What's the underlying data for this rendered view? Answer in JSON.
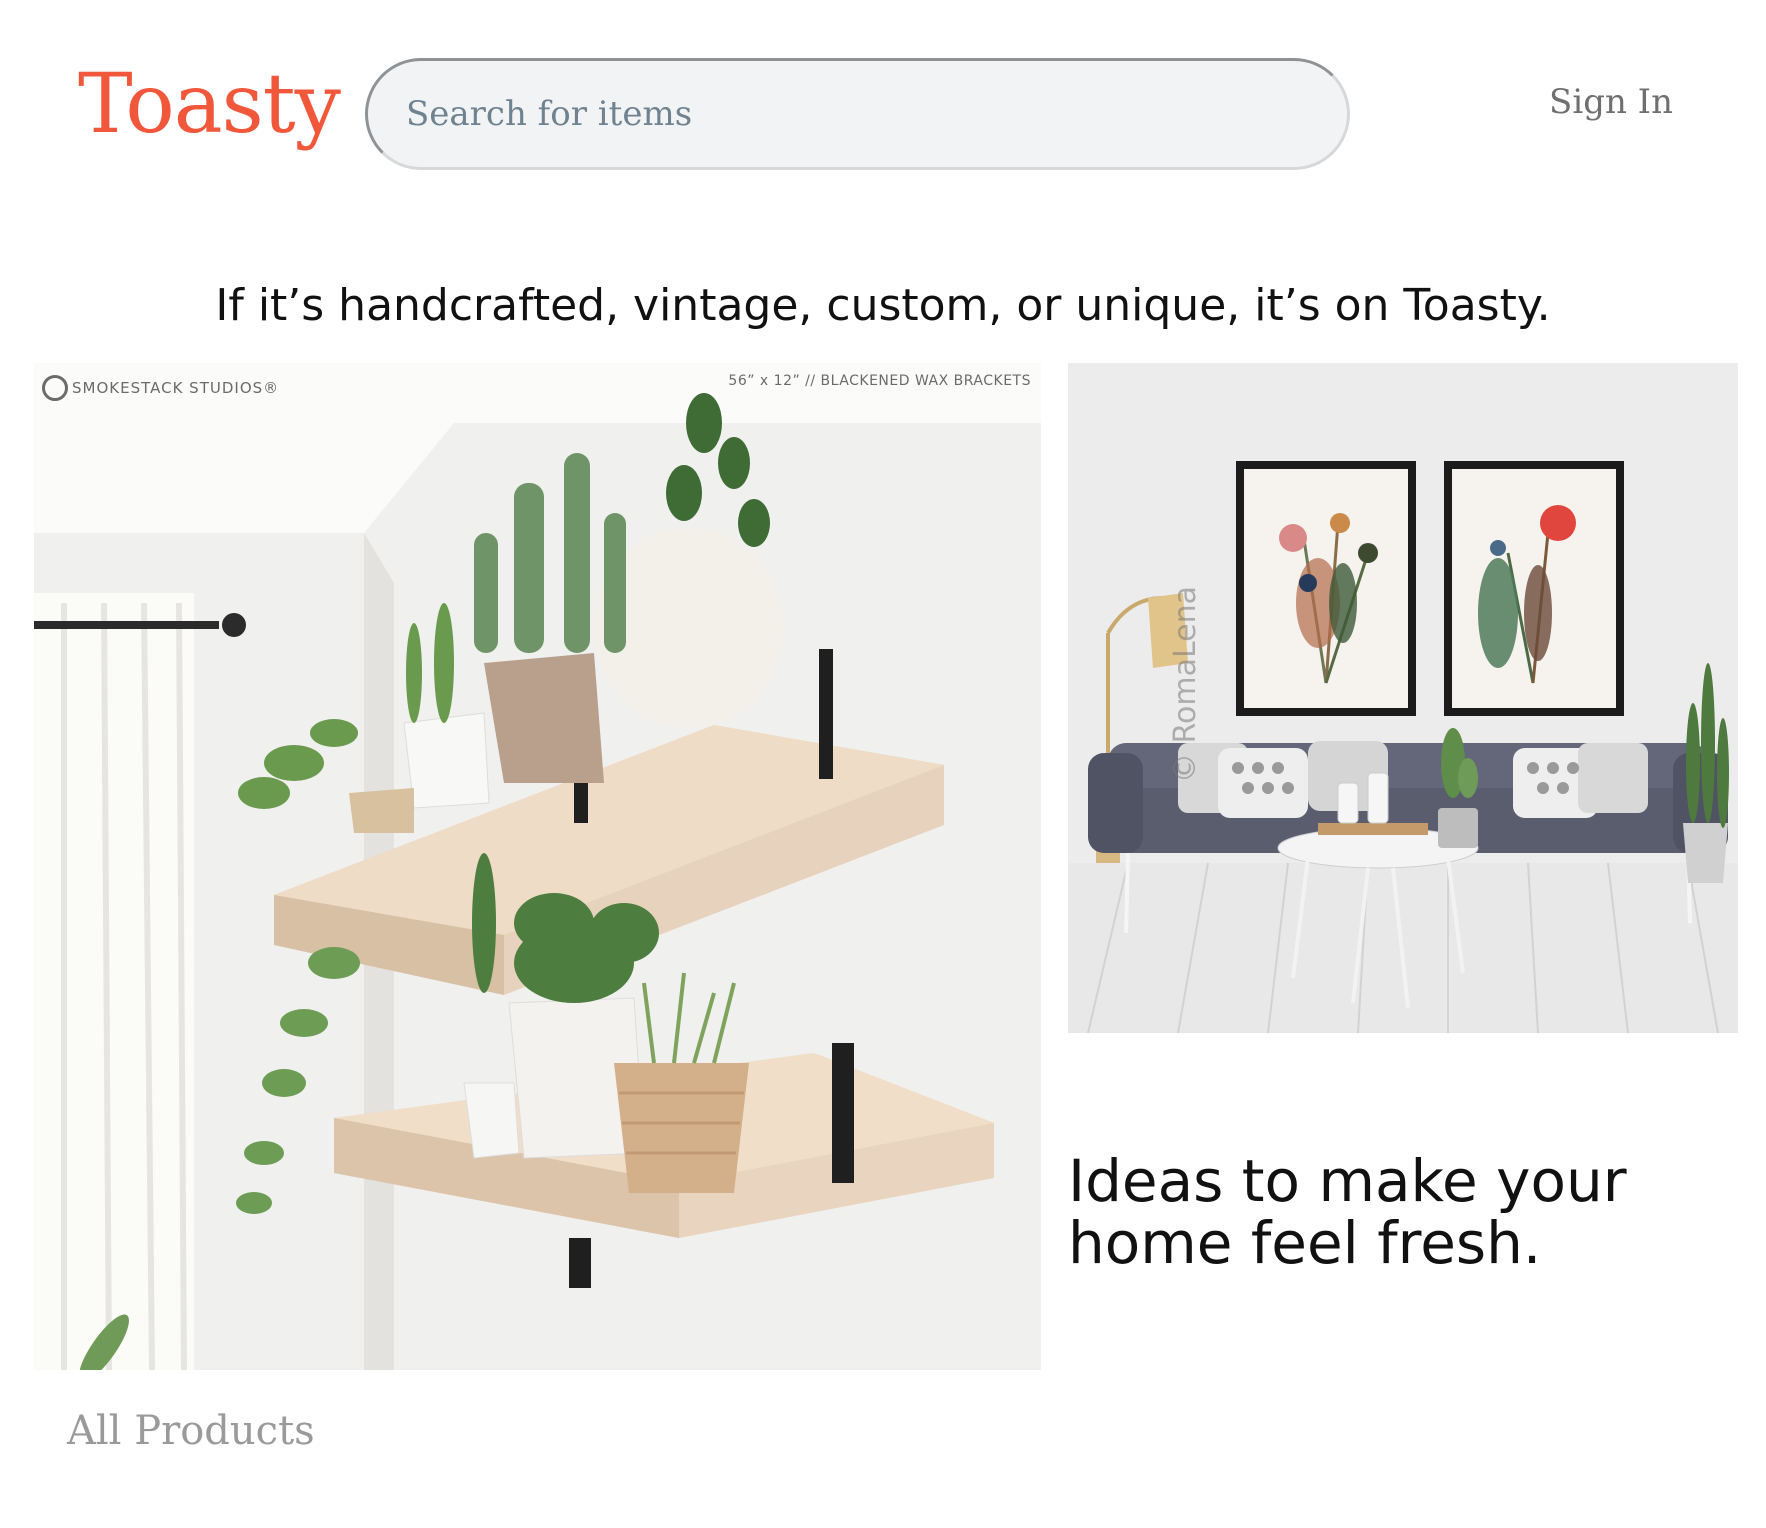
{
  "header": {
    "logo": "Toasty",
    "search_placeholder": "Search for items",
    "sign_in": "Sign In"
  },
  "hero": {
    "tagline": "If it’s handcrafted, vintage, custom, or unique, it’s on Toasty.",
    "left_image": {
      "watermark_brand": "SMOKESTACK STUDIOS®",
      "watermark_caption": "56” x 12” // BLACKENED WAX BRACKETS"
    },
    "right_image": {
      "watermark": "© RomaLena"
    },
    "ideas_text": "Ideas to make your home feel fresh."
  },
  "links": {
    "all_products": "All Products"
  },
  "colors": {
    "brand": "#f1573a",
    "muted_text": "#9a9a9a"
  }
}
